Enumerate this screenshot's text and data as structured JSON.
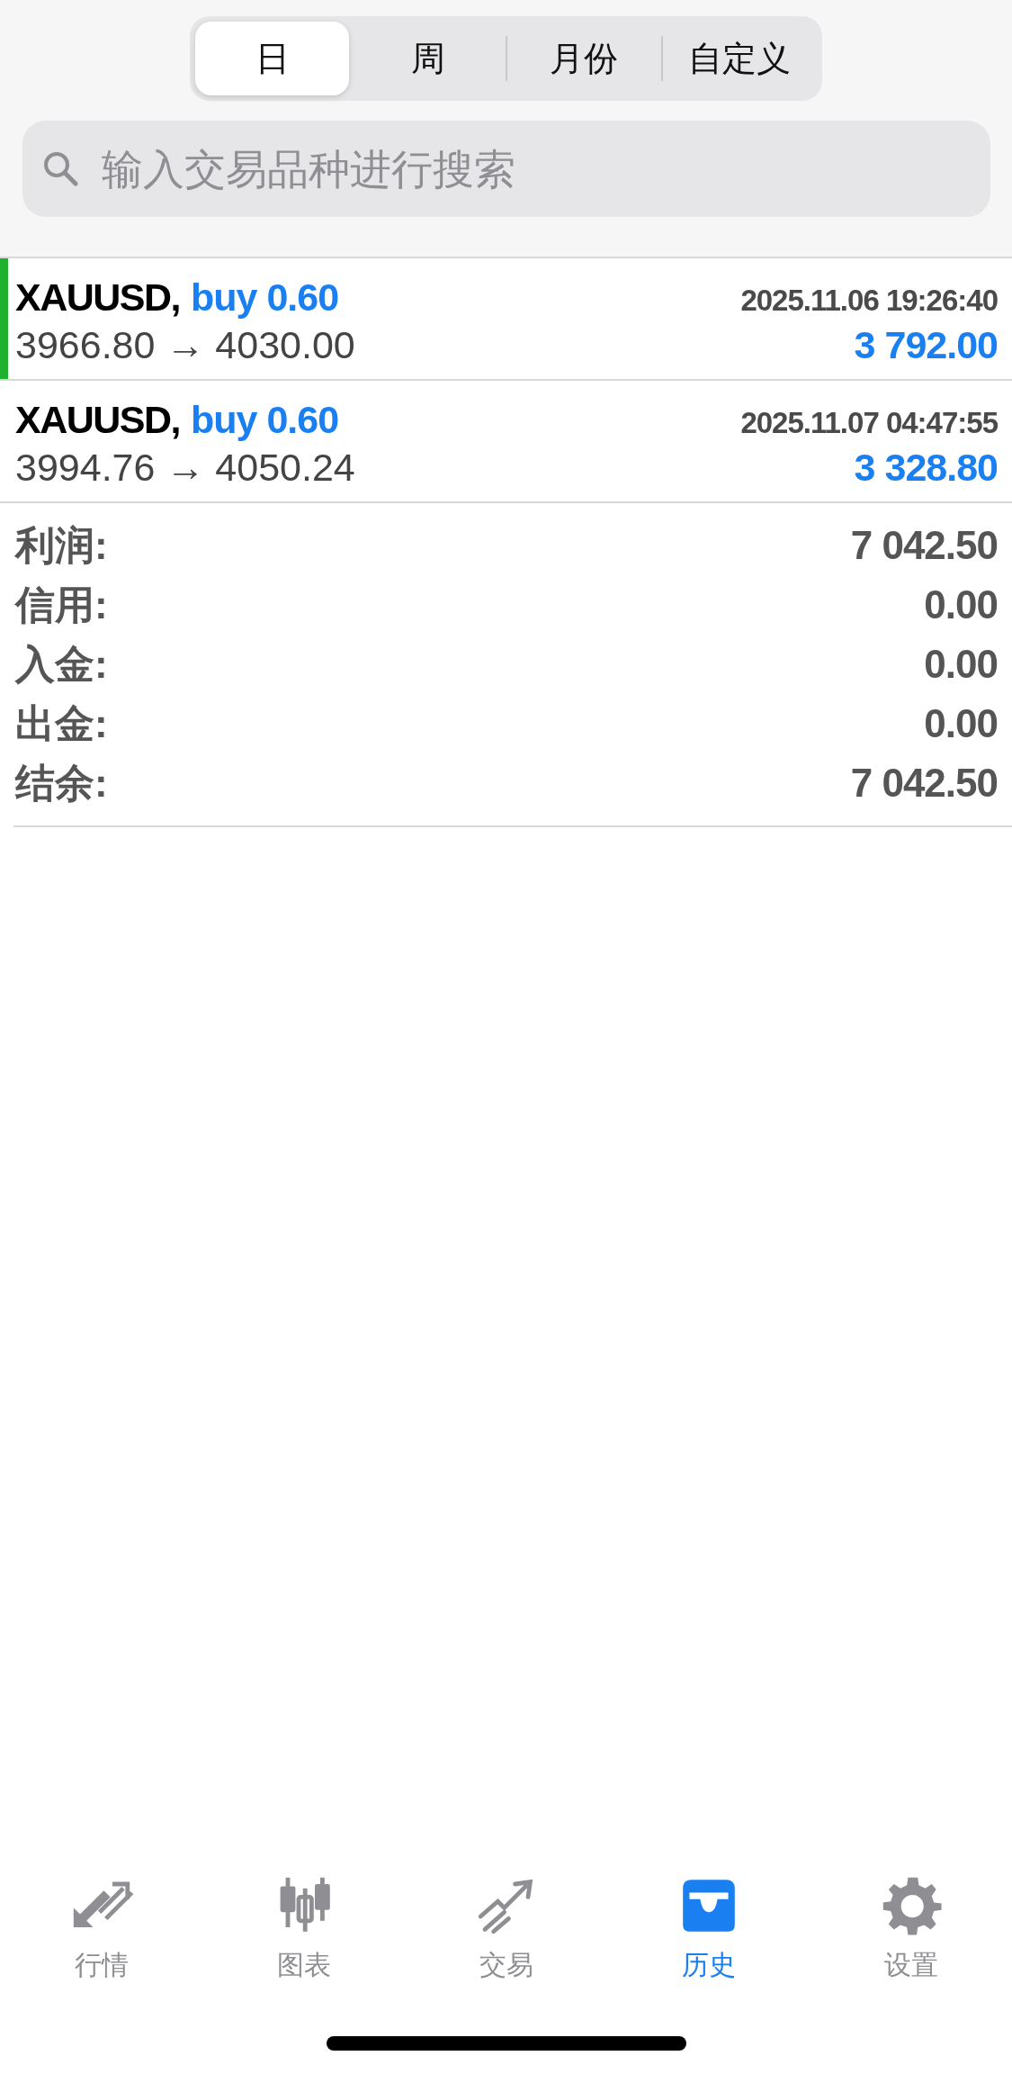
{
  "period_tabs": [
    {
      "label": "日",
      "selected": true
    },
    {
      "label": "周",
      "selected": false
    },
    {
      "label": "月份",
      "selected": false
    },
    {
      "label": "自定义",
      "selected": false
    }
  ],
  "search": {
    "placeholder": "输入交易品种进行搜索"
  },
  "deals": [
    {
      "symbol": "XAUUSD,",
      "side": "buy 0.60",
      "time": "2025.11.06 19:26:40",
      "prices": "3966.80 → 4030.00",
      "profit": "3 792.00",
      "selected": true
    },
    {
      "symbol": "XAUUSD,",
      "side": "buy 0.60",
      "time": "2025.11.07 04:47:55",
      "prices": "3994.76 → 4050.24",
      "profit": "3 328.80",
      "selected": false
    }
  ],
  "summary": [
    {
      "label": "利润:",
      "value": "7 042.50"
    },
    {
      "label": "信用:",
      "value": "0.00"
    },
    {
      "label": "入金:",
      "value": "0.00"
    },
    {
      "label": "出金:",
      "value": "0.00"
    },
    {
      "label": "结余:",
      "value": "7 042.50"
    }
  ],
  "tab_bar": [
    {
      "kind": "quotes",
      "label": "行情",
      "selected": false
    },
    {
      "kind": "chart",
      "label": "图表",
      "selected": false
    },
    {
      "kind": "trade",
      "label": "交易",
      "selected": false
    },
    {
      "kind": "history",
      "label": "历史",
      "selected": true
    },
    {
      "kind": "settings",
      "label": "设置",
      "selected": false
    }
  ]
}
